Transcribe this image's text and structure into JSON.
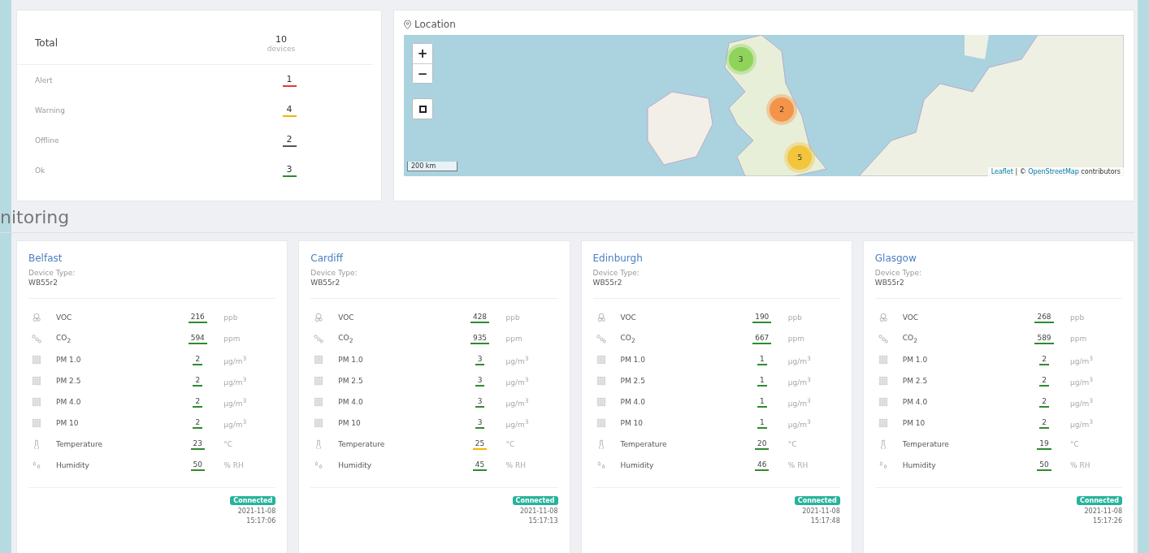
{
  "summary": {
    "total_label": "Total",
    "total_value": "10",
    "total_unit": "devices",
    "statuses": [
      {
        "label": "Alert",
        "count": "1",
        "color": "#e53935"
      },
      {
        "label": "Warning",
        "count": "4",
        "color": "#f4b400"
      },
      {
        "label": "Offline",
        "count": "2",
        "color": "#555555"
      },
      {
        "label": "Ok",
        "count": "3",
        "color": "#2e8b2e"
      }
    ]
  },
  "location": {
    "title": "Location",
    "zoom_in": "+",
    "zoom_out": "−",
    "scale": "200 km",
    "attribution": {
      "link_1": "Leaflet",
      "separator": "| ©",
      "link_2": "OpenStreetMap",
      "suffix": "contributors"
    },
    "clusters": [
      {
        "count": "3",
        "color": "#8fd35a"
      },
      {
        "count": "2",
        "color": "#f4944a"
      },
      {
        "count": "5",
        "color": "#f2c53d"
      }
    ]
  },
  "section_title": "nitoring",
  "devices": [
    {
      "name": "Belfast",
      "type_label": "Device Type:",
      "type": "WB55r2",
      "status": "Connected",
      "date": "2021-11-08",
      "time": "15:17:06",
      "readings": [
        {
          "kind": "voc",
          "label": "VOC",
          "value": "216",
          "unit": "ppb",
          "color": "#2e8b2e"
        },
        {
          "kind": "co2",
          "label": "CO$_{2}$",
          "value": "594",
          "unit": "ppm",
          "color": "#2e8b2e"
        },
        {
          "kind": "pm",
          "label": "PM 1.0",
          "value": "2",
          "unit": "µg/m$^{3}$",
          "color": "#2e8b2e"
        },
        {
          "kind": "pm",
          "label": "PM 2.5",
          "value": "2",
          "unit": "µg/m$^{3}$",
          "color": "#2e8b2e"
        },
        {
          "kind": "pm",
          "label": "PM 4.0",
          "value": "2",
          "unit": "µg/m$^{3}$",
          "color": "#2e8b2e"
        },
        {
          "kind": "pm",
          "label": "PM 10",
          "value": "2",
          "unit": "µg/m$^{3}$",
          "color": "#2e8b2e"
        },
        {
          "kind": "temperature",
          "label": "Temperature",
          "value": "23",
          "unit": "°C",
          "color": "#2e8b2e"
        },
        {
          "kind": "humidity",
          "label": "Humidity",
          "value": "50",
          "unit": "% RH",
          "color": "#2e8b2e"
        }
      ]
    },
    {
      "name": "Cardiff",
      "type_label": "Device Type:",
      "type": "WB55r2",
      "status": "Connected",
      "date": "2021-11-08",
      "time": "15:17:13",
      "readings": [
        {
          "kind": "voc",
          "label": "VOC",
          "value": "428",
          "unit": "ppb",
          "color": "#2e8b2e"
        },
        {
          "kind": "co2",
          "label": "CO$_{2}$",
          "value": "935",
          "unit": "ppm",
          "color": "#2e8b2e"
        },
        {
          "kind": "pm",
          "label": "PM 1.0",
          "value": "3",
          "unit": "µg/m$^{3}$",
          "color": "#2e8b2e"
        },
        {
          "kind": "pm",
          "label": "PM 2.5",
          "value": "3",
          "unit": "µg/m$^{3}$",
          "color": "#2e8b2e"
        },
        {
          "kind": "pm",
          "label": "PM 4.0",
          "value": "3",
          "unit": "µg/m$^{3}$",
          "color": "#2e8b2e"
        },
        {
          "kind": "pm",
          "label": "PM 10",
          "value": "3",
          "unit": "µg/m$^{3}$",
          "color": "#2e8b2e"
        },
        {
          "kind": "temperature",
          "label": "Temperature",
          "value": "25",
          "unit": "°C",
          "color": "#f4b400"
        },
        {
          "kind": "humidity",
          "label": "Humidity",
          "value": "45",
          "unit": "% RH",
          "color": "#2e8b2e"
        }
      ]
    },
    {
      "name": "Edinburgh",
      "type_label": "Device Type:",
      "type": "WB55r2",
      "status": "Connected",
      "date": "2021-11-08",
      "time": "15:17:48",
      "readings": [
        {
          "kind": "voc",
          "label": "VOC",
          "value": "190",
          "unit": "ppb",
          "color": "#2e8b2e"
        },
        {
          "kind": "co2",
          "label": "CO$_{2}$",
          "value": "667",
          "unit": "ppm",
          "color": "#2e8b2e"
        },
        {
          "kind": "pm",
          "label": "PM 1.0",
          "value": "1",
          "unit": "µg/m$^{3}$",
          "color": "#2e8b2e"
        },
        {
          "kind": "pm",
          "label": "PM 2.5",
          "value": "1",
          "unit": "µg/m$^{3}$",
          "color": "#2e8b2e"
        },
        {
          "kind": "pm",
          "label": "PM 4.0",
          "value": "1",
          "unit": "µg/m$^{3}$",
          "color": "#2e8b2e"
        },
        {
          "kind": "pm",
          "label": "PM 10",
          "value": "1",
          "unit": "µg/m$^{3}$",
          "color": "#2e8b2e"
        },
        {
          "kind": "temperature",
          "label": "Temperature",
          "value": "20",
          "unit": "°C",
          "color": "#2e8b2e"
        },
        {
          "kind": "humidity",
          "label": "Humidity",
          "value": "46",
          "unit": "% RH",
          "color": "#2e8b2e"
        }
      ]
    },
    {
      "name": "Glasgow",
      "type_label": "Device Type:",
      "type": "WB55r2",
      "status": "Connected",
      "date": "2021-11-08",
      "time": "15:17:26",
      "readings": [
        {
          "kind": "voc",
          "label": "VOC",
          "value": "268",
          "unit": "ppb",
          "color": "#2e8b2e"
        },
        {
          "kind": "co2",
          "label": "CO$_{2}$",
          "value": "589",
          "unit": "ppm",
          "color": "#2e8b2e"
        },
        {
          "kind": "pm",
          "label": "PM 1.0",
          "value": "2",
          "unit": "µg/m$^{3}$",
          "color": "#2e8b2e"
        },
        {
          "kind": "pm",
          "label": "PM 2.5",
          "value": "2",
          "unit": "µg/m$^{3}$",
          "color": "#2e8b2e"
        },
        {
          "kind": "pm",
          "label": "PM 4.0",
          "value": "2",
          "unit": "µg/m$^{3}$",
          "color": "#2e8b2e"
        },
        {
          "kind": "pm",
          "label": "PM 10",
          "value": "2",
          "unit": "µg/m$^{3}$",
          "color": "#2e8b2e"
        },
        {
          "kind": "temperature",
          "label": "Temperature",
          "value": "19",
          "unit": "°C",
          "color": "#2e8b2e"
        },
        {
          "kind": "humidity",
          "label": "Humidity",
          "value": "50",
          "unit": "% RH",
          "color": "#2e8b2e"
        }
      ]
    }
  ]
}
